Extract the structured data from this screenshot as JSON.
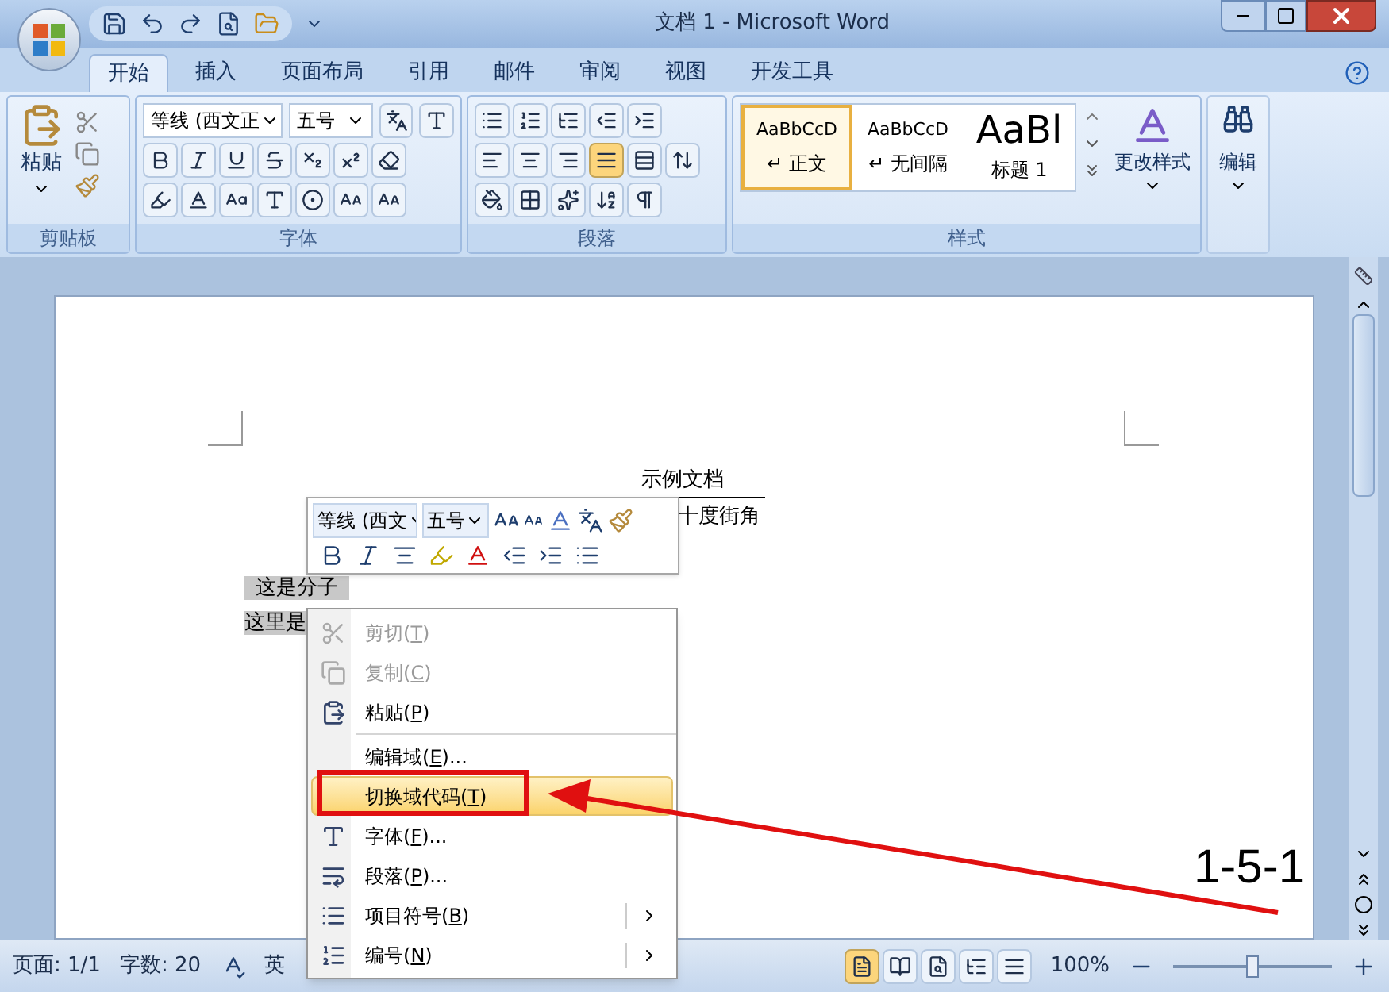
{
  "window": {
    "title": "文档 1 - Microsoft Word"
  },
  "tabs": [
    {
      "label": "开始",
      "selected": true
    },
    {
      "label": "插入",
      "selected": false
    },
    {
      "label": "页面布局",
      "selected": false
    },
    {
      "label": "引用",
      "selected": false
    },
    {
      "label": "邮件",
      "selected": false
    },
    {
      "label": "审阅",
      "selected": false
    },
    {
      "label": "视图",
      "selected": false
    },
    {
      "label": "开发工具",
      "selected": false
    }
  ],
  "ribbon": {
    "clipboard": {
      "paste": "粘贴",
      "group": "剪贴板"
    },
    "font": {
      "font_name": "等线 (西文正",
      "font_size": "五号",
      "group": "字体"
    },
    "paragraph": {
      "group": "段落",
      "alignments": [
        {
          "kind": "left",
          "selected": false
        },
        {
          "kind": "center",
          "selected": false
        },
        {
          "kind": "right",
          "selected": false
        },
        {
          "kind": "justify",
          "selected": true
        },
        {
          "kind": "distributed",
          "selected": false
        }
      ]
    },
    "styles": {
      "group": "样式",
      "change_styles": "更改样式",
      "items": [
        {
          "kind": "body",
          "preview": "AaBbCcD",
          "label": "↵ 正文",
          "selected": true
        },
        {
          "kind": "body",
          "preview": "AaBbCcD",
          "label": "↵ 无间隔",
          "selected": false
        },
        {
          "kind": "heading",
          "preview": "AaBl",
          "label": "标题 1",
          "selected": false
        }
      ]
    },
    "editing": {
      "label": "编辑"
    }
  },
  "document": {
    "field_title": "示例文档",
    "field_subtitle": "十度街角",
    "numerator": "这是分子",
    "denominator": "这里是"
  },
  "mini_toolbar": {
    "font_name": "等线 (西文",
    "font_size": "五号"
  },
  "context_menu": {
    "items": [
      {
        "kind": "item",
        "label": "剪切(T)",
        "disabled": true,
        "selected": false,
        "submenu": false
      },
      {
        "kind": "item",
        "label": "复制(C)",
        "disabled": true,
        "selected": false,
        "submenu": false
      },
      {
        "kind": "item",
        "label": "粘贴(P)",
        "disabled": false,
        "selected": false,
        "submenu": false
      },
      {
        "kind": "separator"
      },
      {
        "kind": "item",
        "label": "编辑域(E)...",
        "disabled": false,
        "selected": false,
        "submenu": false
      },
      {
        "kind": "item",
        "label": "切换域代码(T)",
        "disabled": false,
        "selected": true,
        "submenu": false
      },
      {
        "kind": "item",
        "label": "字体(F)...",
        "disabled": false,
        "selected": false,
        "submenu": false
      },
      {
        "kind": "item",
        "label": "段落(P)...",
        "disabled": false,
        "selected": false,
        "submenu": false
      },
      {
        "kind": "item",
        "label": "项目符号(B)",
        "disabled": false,
        "selected": false,
        "submenu": true
      },
      {
        "kind": "item",
        "label": "编号(N)",
        "disabled": false,
        "selected": false,
        "submenu": true
      }
    ]
  },
  "status_bar": {
    "page": "页面: 1/1",
    "words": "字数: 20",
    "language": "英",
    "zoom": "100%",
    "zoom_slider": {
      "level": 0.5
    }
  },
  "annotation": {
    "step_label": "1-5-1"
  }
}
